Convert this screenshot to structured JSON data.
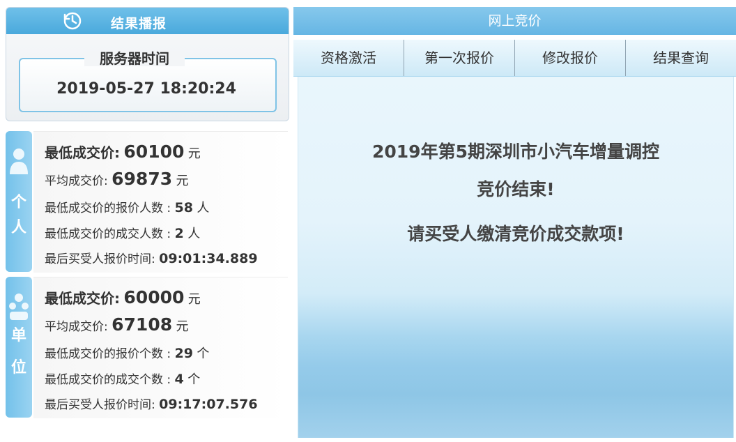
{
  "result_panel": {
    "title": "结果播报",
    "server_label": "服务器时间",
    "server_time": "2019-05-27 18:20:24"
  },
  "person": {
    "tab_chars": [
      "个",
      "人"
    ],
    "min_price_label": "最低成交价:",
    "min_price_value": "60100",
    "avg_price_label": "平均成交价:",
    "avg_price_value": "69873",
    "currency": "元",
    "bid_count_label": "最低成交价的报价人数 :",
    "bid_count_value": "58",
    "bid_count_unit": "人",
    "deal_count_label": "最低成交价的成交人数 :",
    "deal_count_value": "2",
    "deal_count_unit": "人",
    "last_time_label": "最后买受人报价时间:",
    "last_time_value": "09:01:34.889"
  },
  "unit": {
    "tab_chars": [
      "单",
      "位"
    ],
    "min_price_label": "最低成交价:",
    "min_price_value": "60000",
    "avg_price_label": "平均成交价:",
    "avg_price_value": "67108",
    "currency": "元",
    "bid_count_label": "最低成交价的报价个数 :",
    "bid_count_value": "29",
    "bid_count_unit": "个",
    "deal_count_label": "最低成交价的成交个数 :",
    "deal_count_value": "4",
    "deal_count_unit": "个",
    "last_time_label": "最后买受人报价时间:",
    "last_time_value": "09:17:07.576"
  },
  "bidding": {
    "header": "网上竞价",
    "tabs": [
      "资格激活",
      "第一次报价",
      "修改报价",
      "结果查询"
    ],
    "message_line1": "2019年第5期深圳市小汽车增量调控",
    "message_line2": "竞价结束!",
    "message_line3": "请买受人缴清竞价成交款项!"
  },
  "colors": {
    "accent": "#4aa9dc",
    "tab_blue": "#73c1ea"
  }
}
